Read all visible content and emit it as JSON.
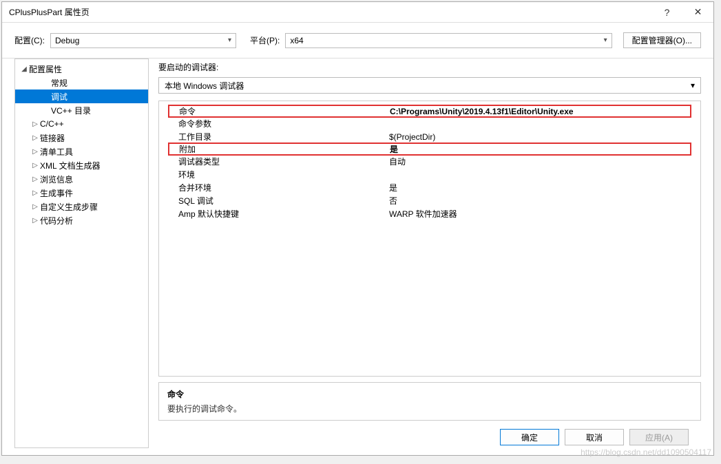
{
  "window": {
    "title": "CPlusPlusPart 属性页"
  },
  "configRow": {
    "configLabel": "配置(C):",
    "configValue": "Debug",
    "platformLabel": "平台(P):",
    "platformValue": "x64",
    "managerBtn": "配置管理器(O)..."
  },
  "tree": [
    {
      "label": "配置属性",
      "arrow": "◢",
      "indent": 0
    },
    {
      "label": "常规",
      "arrow": "",
      "indent": 2
    },
    {
      "label": "调试",
      "arrow": "",
      "indent": 2,
      "selected": true
    },
    {
      "label": "VC++ 目录",
      "arrow": "",
      "indent": 2
    },
    {
      "label": "C/C++",
      "arrow": "▷",
      "indent": 1
    },
    {
      "label": "链接器",
      "arrow": "▷",
      "indent": 1
    },
    {
      "label": "清单工具",
      "arrow": "▷",
      "indent": 1
    },
    {
      "label": "XML 文档生成器",
      "arrow": "▷",
      "indent": 1
    },
    {
      "label": "浏览信息",
      "arrow": "▷",
      "indent": 1
    },
    {
      "label": "生成事件",
      "arrow": "▷",
      "indent": 1
    },
    {
      "label": "自定义生成步骤",
      "arrow": "▷",
      "indent": 1
    },
    {
      "label": "代码分析",
      "arrow": "▷",
      "indent": 1
    }
  ],
  "debugger": {
    "launchLabel": "要启动的调试器:",
    "launchValue": "本地 Windows 调试器"
  },
  "props": [
    {
      "key": "命令",
      "val": "C:\\Programs\\Unity\\2019.4.13f1\\Editor\\Unity.exe",
      "hl": true,
      "bold": true
    },
    {
      "key": "命令参数",
      "val": ""
    },
    {
      "key": "工作目录",
      "val": "$(ProjectDir)"
    },
    {
      "key": "附加",
      "val": "是",
      "hl": true,
      "bold": true
    },
    {
      "key": "调试器类型",
      "val": "自动"
    },
    {
      "key": "环境",
      "val": ""
    },
    {
      "key": "合并环境",
      "val": "是"
    },
    {
      "key": "SQL 调试",
      "val": "否"
    },
    {
      "key": "Amp 默认快捷键",
      "val": "WARP 软件加速器"
    }
  ],
  "desc": {
    "title": "命令",
    "text": "要执行的调试命令。"
  },
  "footer": {
    "ok": "确定",
    "cancel": "取消",
    "apply": "应用(A)"
  },
  "watermark": "https://blog.csdn.net/dd1090504117"
}
